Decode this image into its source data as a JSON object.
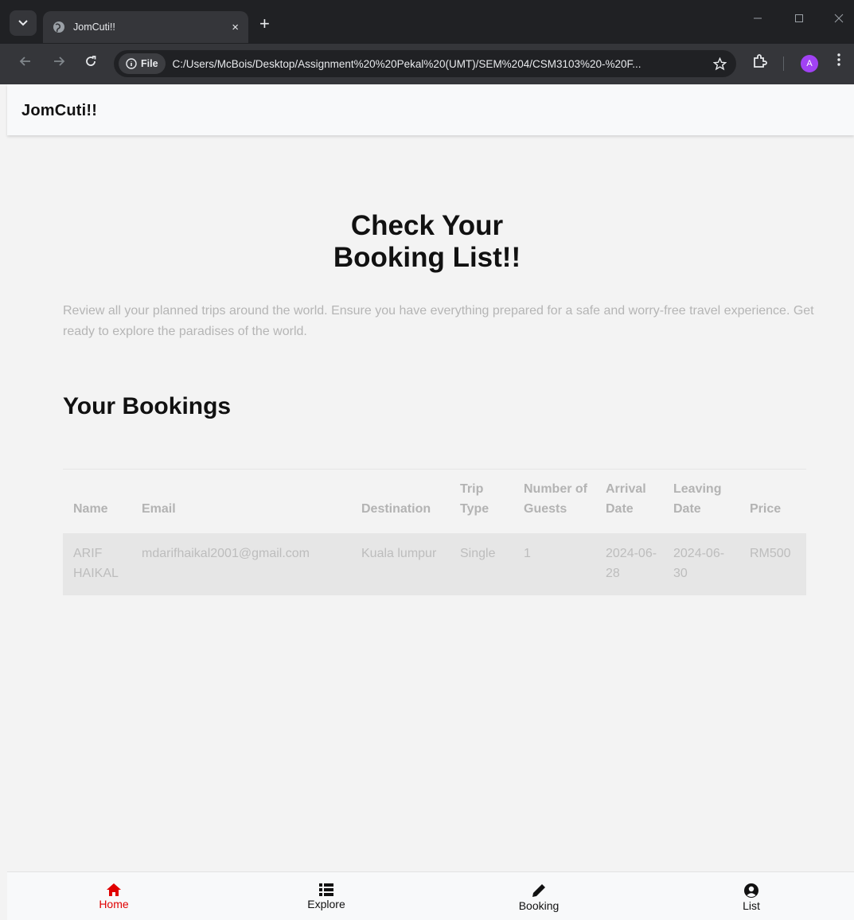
{
  "browser": {
    "tab_title": "JomCuti!!",
    "tab_close": "×",
    "new_tab": "+",
    "file_chip": "File",
    "url": "C:/Users/McBois/Desktop/Assignment%20%20Pekal%20(UMT)/SEM%204/CSM3103%20-%20F...",
    "profile_initial": "A",
    "accent": "#a142f4"
  },
  "navbar": {
    "brand": "JomCuti!!"
  },
  "hero": {
    "title_line1": "Check Your",
    "title_line2": "Booking List!!",
    "description": "Review all your planned trips around the world. Ensure you have everything prepared for a safe and worry-free travel experience. Get ready to explore the paradises of the world."
  },
  "bookings": {
    "section_title": "Your Bookings",
    "columns": [
      "Name",
      "Email",
      "Destination",
      "Trip Type",
      "Number of Guests",
      "Arrival Date",
      "Leaving Date",
      "Price"
    ],
    "rows": [
      [
        "ARIF HAIKAL",
        "mdarifhaikal2001@gmail.com",
        "Kuala lumpur",
        "Single",
        "1",
        "2024-06-28",
        "2024-06-30",
        "RM500"
      ]
    ]
  },
  "bottom_nav": {
    "items": [
      {
        "label": "Home",
        "icon": "home-icon",
        "active": true
      },
      {
        "label": "Explore",
        "icon": "list-icon",
        "active": false
      },
      {
        "label": "Booking",
        "icon": "pencil-icon",
        "active": false
      },
      {
        "label": "List",
        "icon": "user-circle-icon",
        "active": false
      }
    ],
    "active_color": "#e00000"
  }
}
